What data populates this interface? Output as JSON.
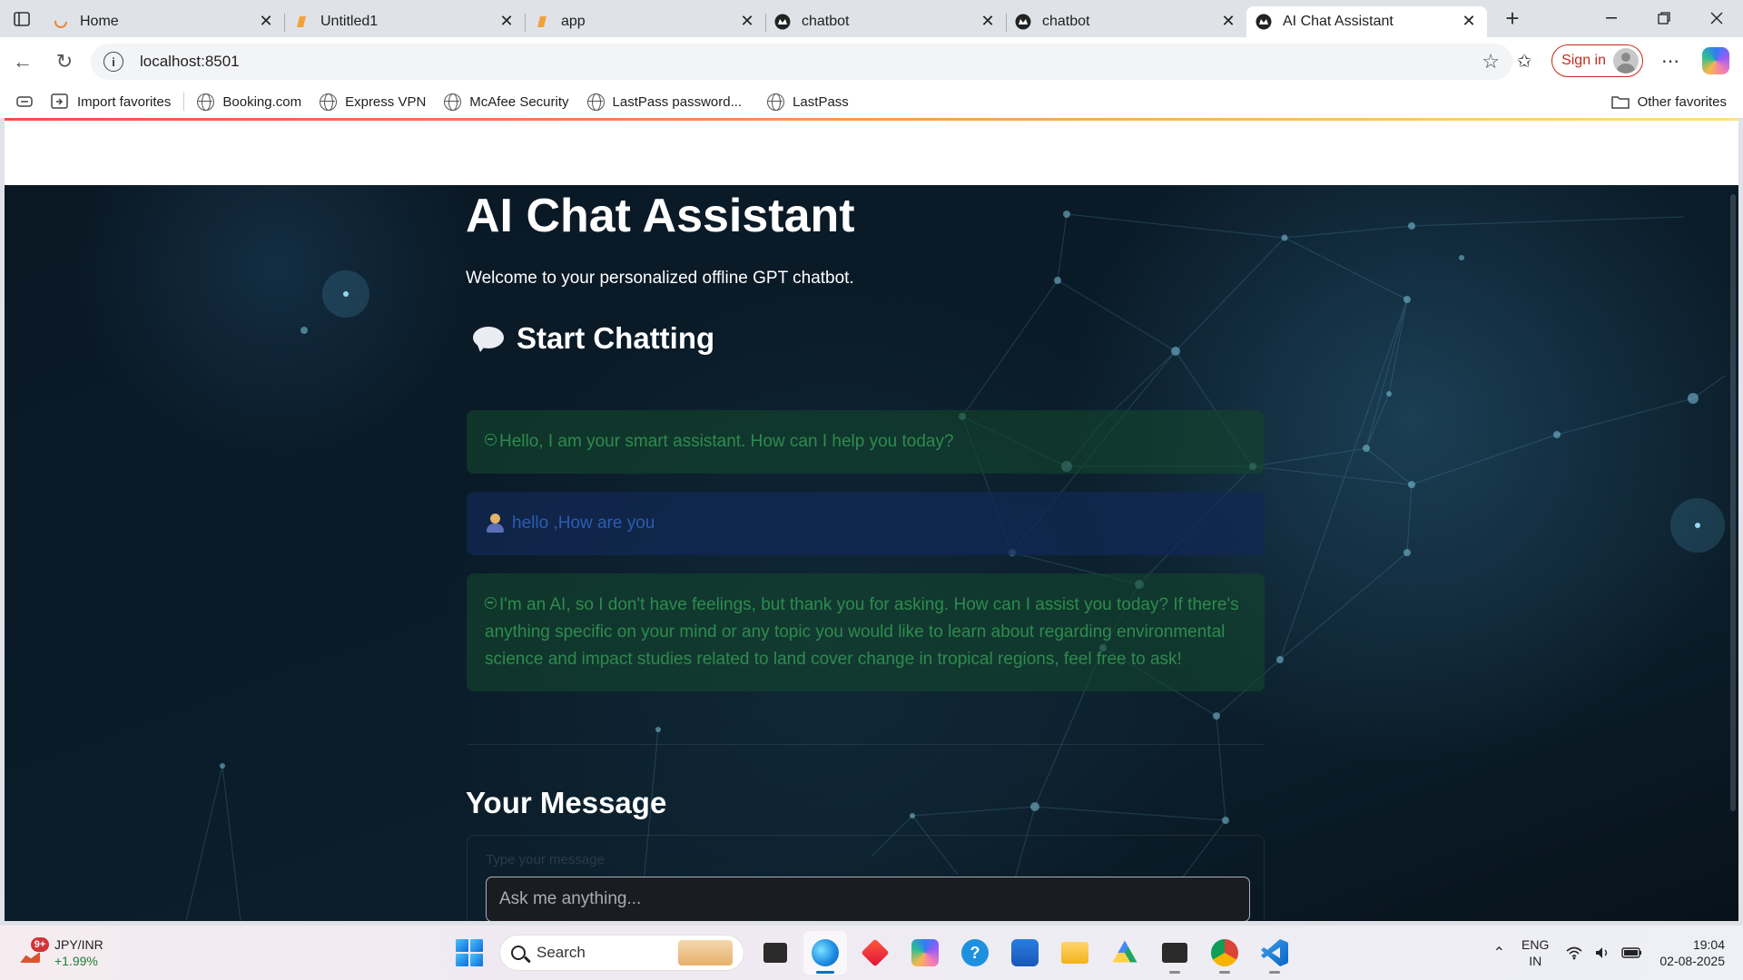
{
  "browser": {
    "tabs": [
      {
        "title": "Home",
        "favicon": "loading-spinner-icon",
        "active": false
      },
      {
        "title": "Untitled1",
        "favicon": "notebook-icon",
        "active": false
      },
      {
        "title": "app",
        "favicon": "notebook-icon",
        "active": false
      },
      {
        "title": "chatbot",
        "favicon": "streamlit-icon",
        "active": false
      },
      {
        "title": "chatbot",
        "favicon": "streamlit-icon",
        "active": false
      },
      {
        "title": "AI Chat Assistant",
        "favicon": "streamlit-icon",
        "active": true
      }
    ],
    "url": "localhost:8501",
    "sign_in_label": "Sign in",
    "favorites": [
      {
        "label": "Import favorites",
        "icon": "import-icon"
      },
      {
        "label": "Booking.com",
        "icon": "globe-icon"
      },
      {
        "label": "Express VPN",
        "icon": "globe-icon"
      },
      {
        "label": "McAfee Security",
        "icon": "globe-icon"
      },
      {
        "label": "LastPass password...",
        "icon": "globe-icon"
      },
      {
        "label": "LastPass",
        "icon": "globe-icon"
      }
    ],
    "other_favorites": "Other favorites"
  },
  "app": {
    "title": "AI Chat Assistant",
    "subtitle": "Welcome to your personalized offline GPT chatbot.",
    "chat_heading": "Start Chatting",
    "messages": [
      {
        "role": "assistant",
        "text": "Hello, I am your smart assistant. How can I help you today?"
      },
      {
        "role": "user",
        "text": "hello ,How are you"
      },
      {
        "role": "assistant",
        "text": "I'm an AI, so I don't have feelings, but thank you for asking. How can I assist you today? If there's anything specific on your mind or any topic you would like to learn about regarding environmental science and impact studies related to land cover change in tropical regions, feel free to ask!"
      }
    ],
    "input_heading": "Your Message",
    "input_label": "Type your message",
    "input_placeholder": "Ask me anything...",
    "colors": {
      "assistant_text": "#2e8b4e",
      "user_text": "#2b5cb3",
      "background": "#0a1b28"
    }
  },
  "taskbar": {
    "widget_badge": "9+",
    "widget_title": "JPY/INR",
    "widget_change": "+1.99%",
    "search_label": "Search",
    "lang_1": "ENG",
    "lang_2": "IN",
    "time": "19:04",
    "date": "02-08-2025"
  }
}
